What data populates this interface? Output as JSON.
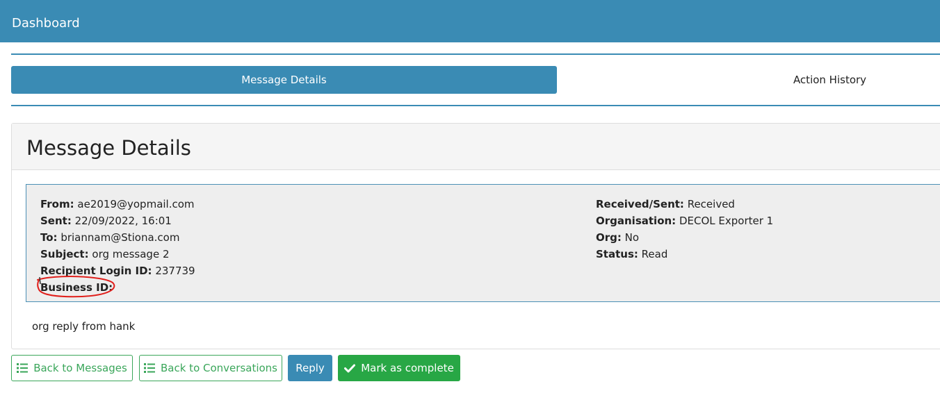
{
  "header": {
    "title": "Dashboard"
  },
  "tabs": [
    {
      "label": "Message Details",
      "active": true
    },
    {
      "label": "Action History",
      "active": false
    }
  ],
  "panel": {
    "title": "Message Details"
  },
  "details_left": [
    {
      "label": "From:",
      "value": "ae2019@yopmail.com"
    },
    {
      "label": "Sent:",
      "value": "22/09/2022, 16:01"
    },
    {
      "label": "To:",
      "value": "briannam@Stiona.com"
    },
    {
      "label": "Subject:",
      "value": "org message 2"
    },
    {
      "label": "Recipient Login ID:",
      "value": "237739"
    },
    {
      "label": "Business ID:",
      "value": ""
    }
  ],
  "details_right": [
    {
      "label": "Received/Sent:",
      "value": "Received"
    },
    {
      "label": "Organisation:",
      "value": "DECOL Exporter 1"
    },
    {
      "label": "Org:",
      "value": "No"
    },
    {
      "label": "Status:",
      "value": "Read"
    }
  ],
  "message_body": "org reply from hank",
  "buttons": {
    "back_messages": "Back to Messages",
    "back_conversations": "Back to Conversations",
    "reply": "Reply",
    "mark_complete": "Mark as complete"
  },
  "colors": {
    "primary": "#3a8bb4",
    "success": "#28a745",
    "annotation": "#e0201c"
  },
  "icons": {
    "list": "list-icon",
    "check": "check-icon"
  }
}
